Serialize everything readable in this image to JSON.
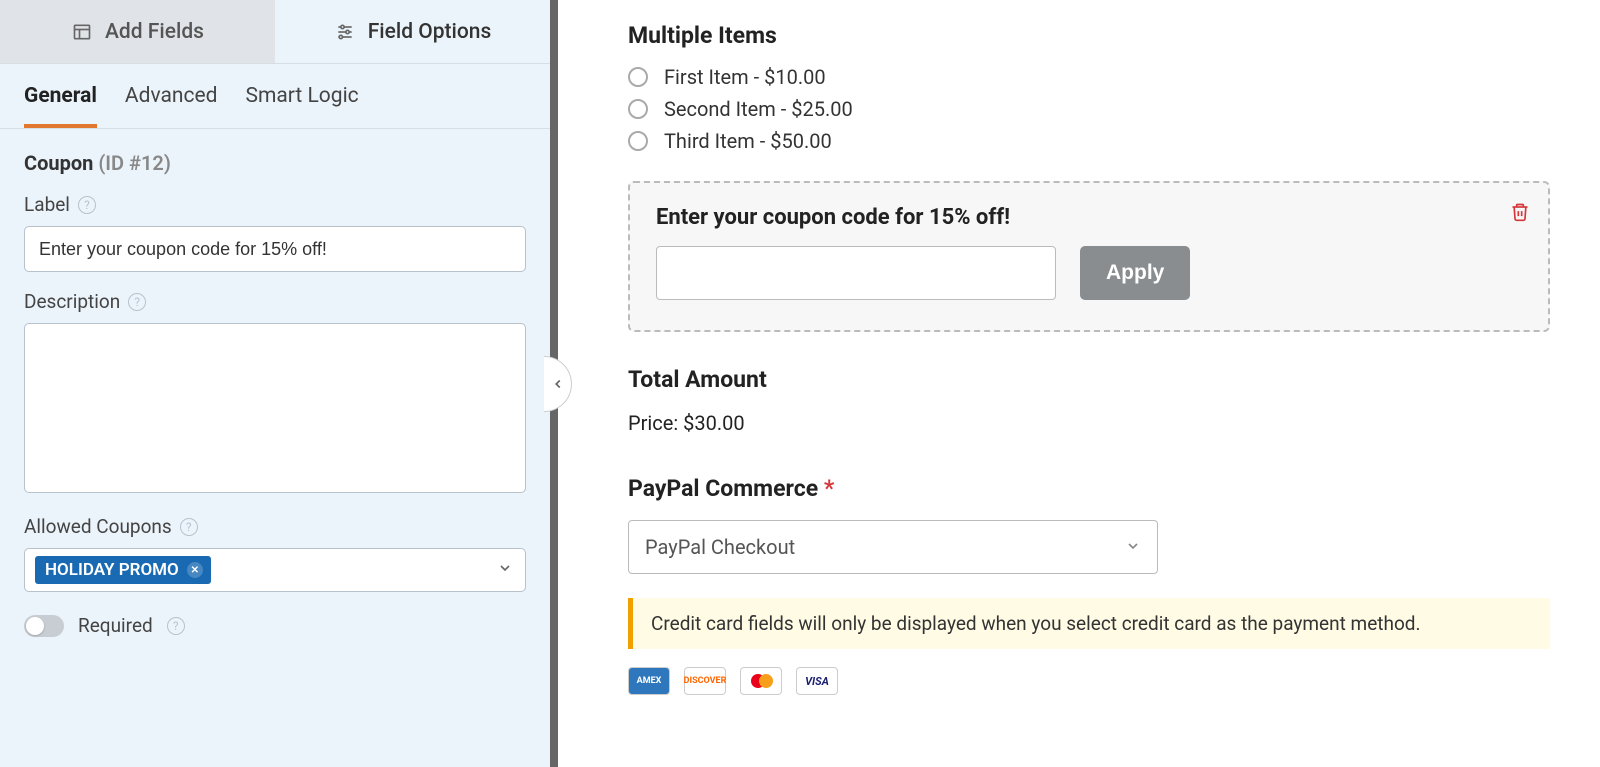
{
  "topTabs": {
    "addFields": "Add Fields",
    "fieldOptions": "Field Options"
  },
  "subTabs": {
    "general": "General",
    "advanced": "Advanced",
    "smartLogic": "Smart Logic"
  },
  "section": {
    "name": "Coupon",
    "id": "(ID #12)"
  },
  "labels": {
    "label": "Label",
    "description": "Description",
    "allowedCoupons": "Allowed Coupons",
    "required": "Required"
  },
  "values": {
    "label": "Enter your coupon code for 15% off!",
    "description": "",
    "allowedCouponChip": "HOLIDAY PROMO"
  },
  "preview": {
    "multipleItemsTitle": "Multiple Items",
    "items": [
      "First Item - $10.00",
      "Second Item - $25.00",
      "Third Item - $50.00"
    ],
    "couponLabel": "Enter your coupon code for 15% off!",
    "applyLabel": "Apply",
    "totalTitle": "Total Amount",
    "priceLine": "Price: $30.00",
    "paypalTitle": "PayPal Commerce",
    "paypalSelected": "PayPal Checkout",
    "ccNotice": "Credit card fields will only be displayed when you select credit card as the payment method.",
    "cards": {
      "amex": "AMEX",
      "discover": "DISCOVER",
      "visa": "VISA"
    }
  }
}
